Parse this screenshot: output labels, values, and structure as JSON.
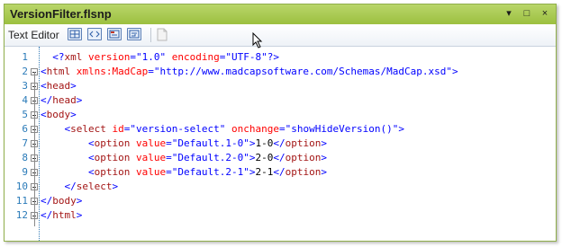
{
  "window": {
    "title": "VersionFilter.flsnp",
    "controls": [
      "▾",
      "□",
      "×"
    ]
  },
  "toolbar": {
    "label": "Text Editor",
    "buttons": [
      {
        "name": "xml-view-button",
        "icon": "grid-view-icon"
      },
      {
        "name": "tag-view-button",
        "icon": "code-tags-icon"
      },
      {
        "name": "tag-bar-button",
        "icon": "tag-bar-icon"
      },
      {
        "name": "wrap-button",
        "icon": "wrap-icon"
      }
    ]
  },
  "editor": {
    "lines": [
      {
        "num": "1",
        "indent": "  ",
        "tokens": [
          [
            "br",
            "<?"
          ],
          [
            "tag",
            "xml"
          ],
          [
            "txt",
            " "
          ],
          [
            "attr",
            "version"
          ],
          [
            "br",
            "="
          ],
          [
            "val",
            "\"1.0\""
          ],
          [
            "txt",
            " "
          ],
          [
            "attr",
            "encoding"
          ],
          [
            "br",
            "="
          ],
          [
            "val",
            "\"UTF-8\""
          ],
          [
            "br",
            "?>"
          ]
        ]
      },
      {
        "num": "2",
        "indent": "",
        "tokens": [
          [
            "br",
            "<"
          ],
          [
            "tag",
            "html"
          ],
          [
            "txt",
            " "
          ],
          [
            "attr",
            "xmlns:MadCap"
          ],
          [
            "br",
            "="
          ],
          [
            "val",
            "\"http://www.madcapsoftware.com/Schemas/MadCap.xsd\""
          ],
          [
            "br",
            ">"
          ]
        ]
      },
      {
        "num": "3",
        "indent": "",
        "tokens": [
          [
            "br",
            "<"
          ],
          [
            "tag",
            "head"
          ],
          [
            "br",
            ">"
          ]
        ]
      },
      {
        "num": "4",
        "indent": "",
        "tokens": [
          [
            "br",
            "</"
          ],
          [
            "tag",
            "head"
          ],
          [
            "br",
            ">"
          ]
        ]
      },
      {
        "num": "5",
        "indent": "",
        "tokens": [
          [
            "br",
            "<"
          ],
          [
            "tag",
            "body"
          ],
          [
            "br",
            ">"
          ]
        ]
      },
      {
        "num": "6",
        "indent": "    ",
        "tokens": [
          [
            "br",
            "<"
          ],
          [
            "tag",
            "select"
          ],
          [
            "txt",
            " "
          ],
          [
            "attr",
            "id"
          ],
          [
            "br",
            "="
          ],
          [
            "val",
            "\"version-select\""
          ],
          [
            "txt",
            " "
          ],
          [
            "attr",
            "onchange"
          ],
          [
            "br",
            "="
          ],
          [
            "val",
            "\"showHideVersion()\""
          ],
          [
            "br",
            ">"
          ]
        ]
      },
      {
        "num": "7",
        "indent": "        ",
        "tokens": [
          [
            "br",
            "<"
          ],
          [
            "tag",
            "option"
          ],
          [
            "txt",
            " "
          ],
          [
            "attr",
            "value"
          ],
          [
            "br",
            "="
          ],
          [
            "val",
            "\"Default.1-0\""
          ],
          [
            "br",
            ">"
          ],
          [
            "txt",
            "1-0"
          ],
          [
            "br",
            "</"
          ],
          [
            "tag",
            "option"
          ],
          [
            "br",
            ">"
          ]
        ]
      },
      {
        "num": "8",
        "indent": "        ",
        "tokens": [
          [
            "br",
            "<"
          ],
          [
            "tag",
            "option"
          ],
          [
            "txt",
            " "
          ],
          [
            "attr",
            "value"
          ],
          [
            "br",
            "="
          ],
          [
            "val",
            "\"Default.2-0\""
          ],
          [
            "br",
            ">"
          ],
          [
            "txt",
            "2-0"
          ],
          [
            "br",
            "</"
          ],
          [
            "tag",
            "option"
          ],
          [
            "br",
            ">"
          ]
        ]
      },
      {
        "num": "9",
        "indent": "        ",
        "tokens": [
          [
            "br",
            "<"
          ],
          [
            "tag",
            "option"
          ],
          [
            "txt",
            " "
          ],
          [
            "attr",
            "value"
          ],
          [
            "br",
            "="
          ],
          [
            "val",
            "\"Default.2-1\""
          ],
          [
            "br",
            ">"
          ],
          [
            "txt",
            "2-1"
          ],
          [
            "br",
            "</"
          ],
          [
            "tag",
            "option"
          ],
          [
            "br",
            ">"
          ]
        ]
      },
      {
        "num": "10",
        "indent": "    ",
        "tokens": [
          [
            "br",
            "</"
          ],
          [
            "tag",
            "select"
          ],
          [
            "br",
            ">"
          ]
        ]
      },
      {
        "num": "11",
        "indent": "",
        "tokens": [
          [
            "br",
            "</"
          ],
          [
            "tag",
            "body"
          ],
          [
            "br",
            ">"
          ]
        ]
      },
      {
        "num": "12",
        "indent": "",
        "tokens": [
          [
            "br",
            "</"
          ],
          [
            "tag",
            "html"
          ],
          [
            "br",
            ">"
          ]
        ]
      }
    ]
  },
  "colors": {
    "titlebar": "#a8c94f",
    "line_numbers": "#2b7bb9",
    "bracket": "#0000ff",
    "tag": "#a31515",
    "attribute": "#ff0000",
    "value": "#0000ff"
  }
}
